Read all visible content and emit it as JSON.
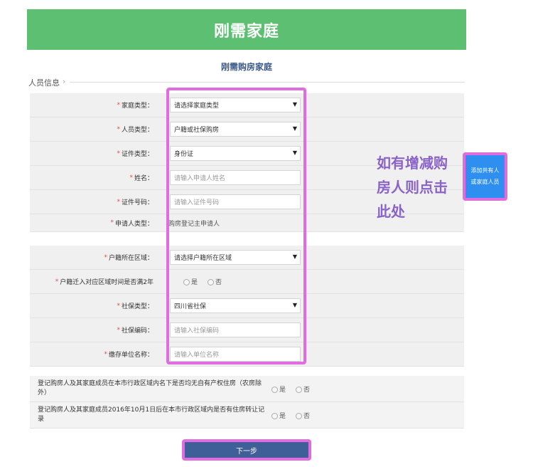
{
  "header": {
    "title": "刚需家庭"
  },
  "subtitle": "刚需购房家庭",
  "section": {
    "title": "人员信息",
    "chevron_icon": "chevron-right-icon"
  },
  "group1": [
    {
      "label": "家庭类型：",
      "type": "select",
      "value": "请选择家庭类型"
    },
    {
      "label": "人员类型：",
      "type": "select",
      "value": "户籍或社保购房"
    },
    {
      "label": "证件类型：",
      "type": "select",
      "value": "身份证"
    },
    {
      "label": "姓名：",
      "type": "input",
      "placeholder": "请输入申请人姓名"
    },
    {
      "label": "证件号码：",
      "type": "input",
      "placeholder": "请输入证件号码"
    },
    {
      "label": "申请人类型：",
      "type": "static",
      "value": "购房登记主申请人"
    }
  ],
  "group2": [
    {
      "label": "户籍所在区域：",
      "type": "select",
      "value": "请选择户籍所在区域"
    },
    {
      "label": "户籍迁入对应区域时间是否满2年",
      "type": "radio",
      "options": [
        "是",
        "否"
      ]
    },
    {
      "label": "社保类型：",
      "type": "select",
      "value": "四川省社保"
    },
    {
      "label": "社保编码：",
      "type": "input",
      "placeholder": "请输入社保编码"
    },
    {
      "label": "缴存单位名称：",
      "type": "input",
      "placeholder": "请输入单位名称"
    }
  ],
  "questions": [
    {
      "text": "登记购房人及其家庭成员在本市行政区域内名下是否均无自有产权住房（农房除外）",
      "options": [
        "是",
        "否"
      ]
    },
    {
      "text": "登记购房人及其家庭成员2016年10月1日后在本市行政区域内是否有住房转让记录",
      "options": [
        "是",
        "否"
      ]
    }
  ],
  "annotation": {
    "lines": [
      "如有增减购",
      "房人则点击",
      "此处"
    ]
  },
  "add_button": {
    "line1": "添加共有人",
    "line2": "或家庭人员"
  },
  "next_button": "下一步",
  "colors": {
    "header_bg": "#5cbf72",
    "highlight": "#e06ce0",
    "annotation": "#8a63c8",
    "add_button": "#2e8ff0",
    "next_button": "#3f5f99",
    "required_star": "#d9534f"
  }
}
